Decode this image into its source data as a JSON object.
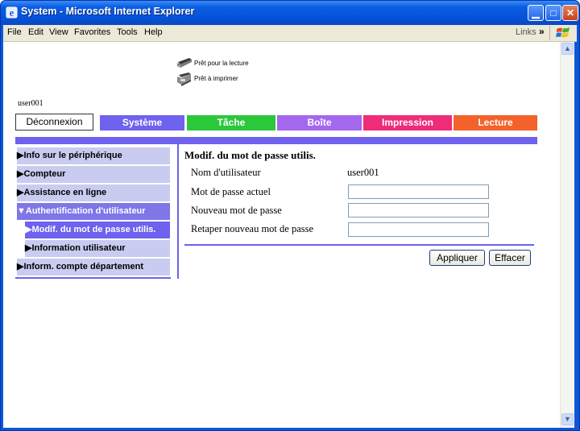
{
  "window": {
    "title": "System - Microsoft Internet Explorer"
  },
  "menubar": {
    "items": [
      "File",
      "Edit",
      "View",
      "Favorites",
      "Tools",
      "Help"
    ],
    "links_label": "Links",
    "links_chevron": "»"
  },
  "status": {
    "ready_scan": "Prêt pour la lecture",
    "ready_print": "Prêt à imprimer"
  },
  "user": "user001",
  "tabs": {
    "logout": "Déconnexion",
    "items": [
      {
        "label": "Système",
        "color": "#6e62ee"
      },
      {
        "label": "Tâche",
        "color": "#2bc83c"
      },
      {
        "label": "Boîte",
        "color": "#a468ee"
      },
      {
        "label": "Impression",
        "color": "#ee2c79"
      },
      {
        "label": "Lecture",
        "color": "#f2622a"
      }
    ]
  },
  "nav": {
    "items": [
      {
        "label": "▶Info sur le périphérique"
      },
      {
        "label": "▶Compteur"
      },
      {
        "label": "▶Assistance en ligne"
      },
      {
        "label": "▼Authentification d'utilisateur"
      },
      {
        "label": "▶Modif. du mot de passe utilis."
      },
      {
        "label": "▶Information utilisateur"
      },
      {
        "label": "▶Inform. compte département"
      }
    ]
  },
  "form": {
    "title": "Modif. du mot de passe utilis.",
    "username_label": "Nom d'utilisateur",
    "username_value": "user001",
    "current_password_label": "Mot de passe actuel",
    "new_password_label": "Nouveau mot de passe",
    "retype_password_label": "Retaper nouveau mot de passe",
    "current_password_value": "",
    "new_password_value": "",
    "retype_password_value": "",
    "apply_label": "Appliquer",
    "clear_label": "Effacer"
  },
  "colors": {
    "accent": "#6e62ee",
    "nav_bg": "#c9cbf0",
    "titlebar": "#0a58d8"
  }
}
